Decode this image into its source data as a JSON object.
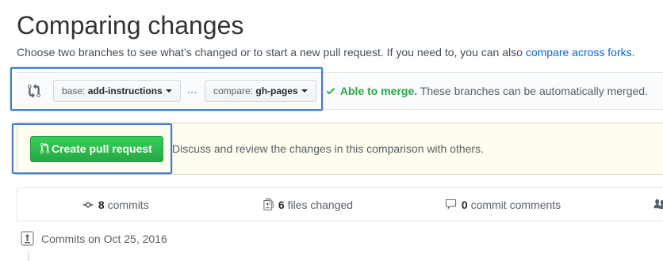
{
  "page": {
    "title": "Comparing changes",
    "subtitle_text": "Choose two branches to see what’s changed or to start a new pull request. If you need to, you can also",
    "subtitle_link": "compare across forks",
    "subtitle_end": "."
  },
  "range": {
    "base_label": "base:",
    "base_branch": "add-instructions",
    "ellipsis": "…",
    "compare_label": "compare:",
    "compare_branch": "gh-pages",
    "merge_status": "Able to merge.",
    "merge_message": "These branches can be automatically merged."
  },
  "create": {
    "button_label": "Create pull request",
    "description": "Discuss and review the changes in this comparison with others."
  },
  "summary": {
    "commits_count": "8",
    "commits_label": "commits",
    "files_count": "6",
    "files_label": "files changed",
    "comments_count": "0",
    "comments_label": "commit comments"
  },
  "commits": {
    "day_header": "Commits on Oct 25, 2016"
  },
  "colors": {
    "accent_link": "#0366d6",
    "success": "#28a745",
    "highlight": "#3f7ec9"
  },
  "icons": [
    "git-compare-icon",
    "chevron-down-icon",
    "check-icon",
    "git-pull-request-icon",
    "git-commit-icon",
    "file-diff-icon",
    "comment-icon",
    "organization-icon",
    "repo-push-icon"
  ]
}
